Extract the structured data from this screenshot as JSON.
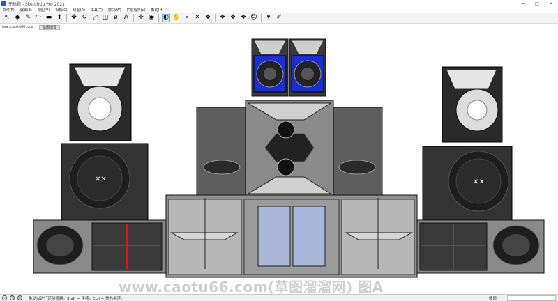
{
  "window": {
    "title": "无标题 - SketchUp Pro 2021",
    "controls": [
      "—",
      "□",
      "✕"
    ]
  },
  "menu": [
    "文件(F)",
    "编辑(E)",
    "视图(V)",
    "相机(C)",
    "绘图(R)",
    "工具(T)",
    "窗口(W)",
    "扩展程序(x)",
    "帮助(H)"
  ],
  "toolbar": {
    "tools": [
      {
        "icon": "select-arrow-icon",
        "glyph": "↖"
      },
      {
        "icon": "eraser-icon",
        "glyph": "◆"
      },
      {
        "icon": "pencil-icon",
        "glyph": "✎"
      },
      {
        "icon": "arc-icon",
        "glyph": "◠"
      },
      {
        "icon": "shape-icon",
        "glyph": "▬"
      },
      {
        "icon": "push-pull-icon",
        "glyph": "⬆"
      },
      {
        "icon": "move-icon",
        "glyph": "✥"
      },
      {
        "icon": "rotate-icon",
        "glyph": "↻"
      },
      {
        "icon": "scale-icon",
        "glyph": "⤢"
      },
      {
        "icon": "offset-icon",
        "glyph": "◫"
      },
      {
        "icon": "tape-measure-icon",
        "glyph": "⌀"
      },
      {
        "icon": "text-icon",
        "glyph": "A"
      },
      {
        "icon": "axes-icon",
        "glyph": "✛"
      },
      {
        "icon": "paint-bucket-icon",
        "glyph": "◉"
      },
      {
        "icon": "orbit-icon",
        "glyph": "◐"
      },
      {
        "icon": "pan-icon",
        "glyph": "✋"
      },
      {
        "icon": "zoom-icon",
        "glyph": "⌕"
      },
      {
        "icon": "zoom-extents-icon",
        "glyph": "✕"
      },
      {
        "icon": "warehouse-icon",
        "glyph": "❖"
      },
      {
        "icon": "extension-warehouse-icon",
        "glyph": "❖"
      },
      {
        "icon": "layout-icon",
        "glyph": "❖"
      },
      {
        "icon": "style-builder-icon",
        "glyph": "❖"
      },
      {
        "icon": "account-icon",
        "glyph": "☺"
      },
      {
        "icon": "dropdown-icon",
        "glyph": "▾"
      },
      {
        "icon": "notes-icon",
        "glyph": "✐"
      }
    ]
  },
  "scene_row": {
    "site_tag": "www.caotu66.com",
    "scene_tab": "草图溜溜"
  },
  "viewport": {
    "watermark": "www.caotu66.com(草图溜溜网) 图A"
  },
  "status": {
    "hint": "拖动以进行环绕观察。Shift = 平移。Ctrl = 重力悬浮。",
    "measurements_label": "数值"
  },
  "colors": {
    "speaker_dark": "#2b2b2b",
    "cabinet_gray": "#6e6e6e",
    "panel_light": "#bdbdbd",
    "accent_blue": "#1b2fd0",
    "accent_red": "#e01515"
  }
}
